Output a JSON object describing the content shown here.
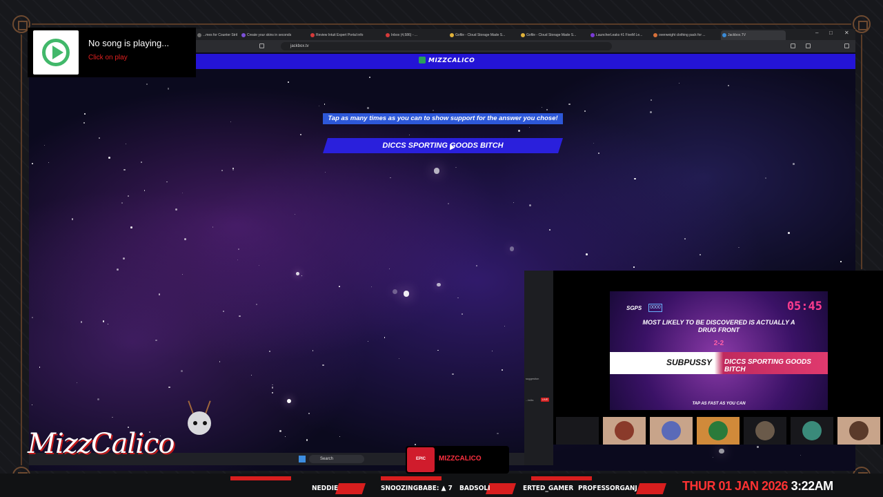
{
  "music": {
    "title": "No song is playing...",
    "action": "Click on play",
    "icon": "music-play-icon"
  },
  "browser": {
    "tabs": [
      {
        "label": "...mes for Counter Strike",
        "color": "#6c6c6c"
      },
      {
        "label": "Create your skins in seconds",
        "color": "#7b4fd6"
      },
      {
        "label": "Review Intuit Expert Portal info",
        "color": "#d63a3a"
      },
      {
        "label": "Inbox (4,586) - ...",
        "color": "#d63a3a"
      },
      {
        "label": "Gofile - Cloud Storage Made S...",
        "color": "#e0b23a"
      },
      {
        "label": "Gofile - Cloud Storage Made S...",
        "color": "#e0b23a"
      },
      {
        "label": "LauncherLeaks #1 FiveM Le...",
        "color": "#7a3ad6"
      },
      {
        "label": "overweight clothing pack for ...",
        "color": "#d6703a"
      },
      {
        "label": "Jackbox.TV",
        "color": "#3a8ad6"
      }
    ],
    "url": "jackbox.tv"
  },
  "jackbox": {
    "logo": "MIZZCALICO",
    "prompt": "Tap as many times as you can to show support for the answer you chose!",
    "answer": "DICCS SPORTING GOODS BITCH"
  },
  "game": {
    "hud_left": "SGPS",
    "hud_mid": "0000",
    "timer": "05:45",
    "question": "MOST LIKELY TO BE DISCOVERED IS ACTUALLY A DRUG FRONT",
    "score": "2-2",
    "answer_a": "SUBPUSSY",
    "answer_b": "DICCS SPORTING GOODS BITCH",
    "tap": "TAP AS FAST AS YOU CAN"
  },
  "side_panel": {
    "suggestion": "suggestion",
    "live": "LIVE",
    "label": "...teAs"
  },
  "taskbar": {
    "search": "Search"
  },
  "follow": {
    "platform": "EPIC",
    "name": "MIZZCALICO"
  },
  "brand": {
    "name": "MizzCalico"
  },
  "ticker": {
    "names": [
      "NEDDIE",
      "SNOOZINGBABE: ▲ 7",
      "BADSOLI",
      "ERTED_GAMER",
      "PROFESSORGANJ"
    ],
    "date": "THUR 01 JAN 2026",
    "time": "3:22AM"
  },
  "colors": {
    "accent": "#d81e1e",
    "jackbox_blue": "#2414d6",
    "music_green": "#41b86a"
  }
}
